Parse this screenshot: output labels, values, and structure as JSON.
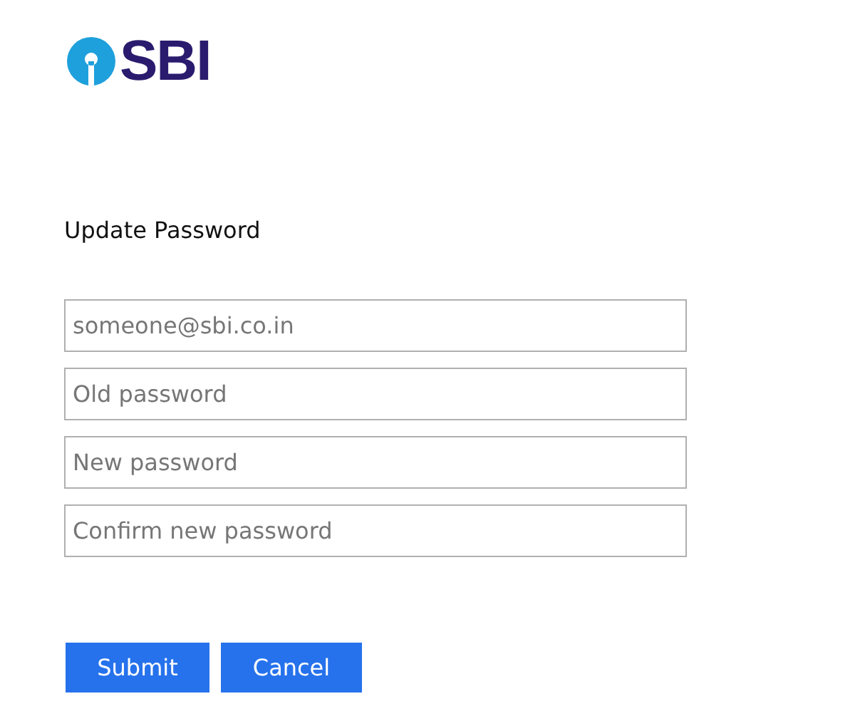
{
  "logo": {
    "text": "SBI"
  },
  "heading": "Update Password",
  "fields": [
    {
      "placeholder": "someone@sbi.co.in"
    },
    {
      "placeholder": "Old password"
    },
    {
      "placeholder": "New password"
    },
    {
      "placeholder": "Confirm new password"
    }
  ],
  "buttons": [
    "Submit",
    "Cancel"
  ]
}
